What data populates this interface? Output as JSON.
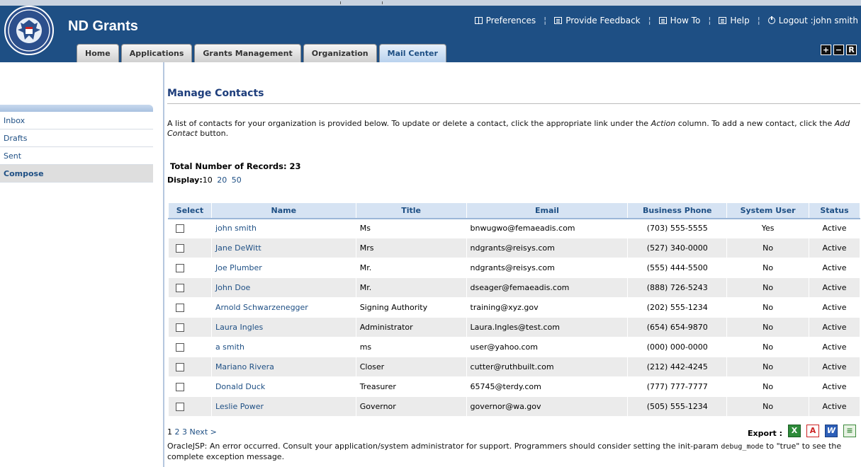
{
  "header": {
    "app_title": "ND Grants",
    "nav": [
      {
        "label": "Preferences",
        "icon": "book-icon"
      },
      {
        "label": "Provide Feedback",
        "icon": "list-icon"
      },
      {
        "label": "How To",
        "icon": "list-icon"
      },
      {
        "label": "Help",
        "icon": "list-icon"
      },
      {
        "label": "Logout :john smith",
        "icon": "power-icon"
      }
    ],
    "nav_separator": "¦",
    "tabs": [
      "Home",
      "Applications",
      "Grants Management",
      "Organization",
      "Mail Center"
    ],
    "active_tab": "Mail Center",
    "size_buttons": [
      "+",
      "−",
      "R"
    ]
  },
  "sidebar": {
    "items": [
      "Inbox",
      "Drafts",
      "Sent",
      "Compose"
    ],
    "active": "Compose"
  },
  "main": {
    "title": "Manage Contacts",
    "intro_part1": "A list of contacts for your organization is provided below. To update or delete a contact, click the appropriate link under the ",
    "intro_action": "Action",
    "intro_part2": " column. To add a new contact, click the ",
    "intro_add": "Add Contact",
    "intro_part3": " button.",
    "total_records": "Total Number of Records: 23",
    "display_label": "Display:",
    "display_options": [
      "10",
      "20",
      "50"
    ],
    "table": {
      "headers": [
        "Select",
        "Name",
        "Title",
        "Email",
        "Business Phone",
        "System User",
        "Status"
      ],
      "rows": [
        {
          "name": "john smith",
          "title": "Ms",
          "email": "bnwugwo@femaeadis.com",
          "phone": "(703) 555-5555",
          "system_user": "Yes",
          "status": "Active"
        },
        {
          "name": "Jane DeWitt",
          "title": "Mrs",
          "email": "ndgrants@reisys.com",
          "phone": "(527) 340-0000",
          "system_user": "No",
          "status": "Active"
        },
        {
          "name": "Joe Plumber",
          "title": "Mr.",
          "email": "ndgrants@reisys.com",
          "phone": "(555) 444-5500",
          "system_user": "No",
          "status": "Active"
        },
        {
          "name": "John Doe",
          "title": "Mr.",
          "email": "dseager@femaeadis.com",
          "phone": "(888) 726-5243",
          "system_user": "No",
          "status": "Active"
        },
        {
          "name": "Arnold Schwarzenegger",
          "title": "Signing Authority",
          "email": "training@xyz.gov",
          "phone": "(202) 555-1234",
          "system_user": "No",
          "status": "Active"
        },
        {
          "name": "Laura Ingles",
          "title": "Administrator",
          "email": "Laura.Ingles@test.com",
          "phone": "(654) 654-9870",
          "system_user": "No",
          "status": "Active"
        },
        {
          "name": "a smith",
          "title": "ms",
          "email": "user@yahoo.com",
          "phone": "(000) 000-0000",
          "system_user": "No",
          "status": "Active"
        },
        {
          "name": "Mariano Rivera",
          "title": "Closer",
          "email": "cutter@ruthbuilt.com",
          "phone": "(212) 442-4245",
          "system_user": "No",
          "status": "Active"
        },
        {
          "name": "Donald Duck",
          "title": "Treasurer",
          "email": "65745@terdy.com",
          "phone": "(777) 777-7777",
          "system_user": "No",
          "status": "Active"
        },
        {
          "name": "Leslie Power",
          "title": "Governor",
          "email": "governor@wa.gov",
          "phone": "(505) 555-1234",
          "system_user": "No",
          "status": "Active"
        }
      ]
    },
    "pager": {
      "current": "1",
      "pages": [
        "2",
        "3"
      ],
      "next": "Next >"
    },
    "export_label": "Export :",
    "export_icons": [
      "excel-icon",
      "pdf-icon",
      "word-icon",
      "csv-icon"
    ],
    "error_part1": "OracleJSP: An error occurred. Consult your application/system administrator for support. Programmers should consider setting the init-param ",
    "error_code": "debug_mode",
    "error_part2": " to \"true\" to see the complete exception message."
  }
}
